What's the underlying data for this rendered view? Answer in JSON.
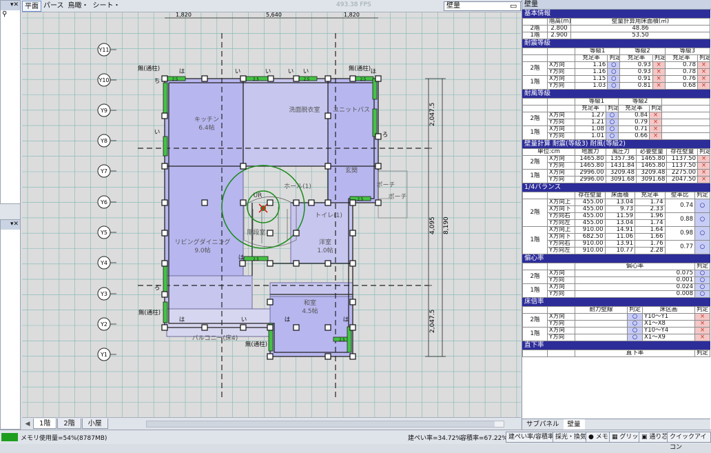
{
  "toolbar": {
    "modes": [
      "平面",
      "パース",
      "鳥瞰・",
      "シート・"
    ],
    "fps": "493.38 FPS",
    "layer": "壁量"
  },
  "floor_tabs": [
    "1階",
    "2階",
    "小屋"
  ],
  "plan": {
    "grid_y": [
      "Y11",
      "Y10",
      "Y9",
      "Y8",
      "Y7",
      "Y6",
      "Y5",
      "Y4",
      "Y3",
      "Y2",
      "Y1"
    ],
    "rooms": {
      "kitchen": "キッチン",
      "kitchen_size": "6.4帖",
      "washroom": "洗面脱衣室",
      "bath": "ユニットバス",
      "entrance": "玄関",
      "hall": "ホール(1)",
      "porch": "ポーチ",
      "porch2": "ポーチ",
      "toilet": "トイレ(1)",
      "living": "リビングダイニング",
      "living_size": "9.0帖",
      "western": "洋室",
      "western_size": "1.0帖",
      "japanese": "和室",
      "japanese_size": "4.5帖",
      "stair": "階段室",
      "balcony": "バルコニー(床4)",
      "ur": "UR"
    },
    "labels": {
      "mu_tsuchu": "無(通柱)",
      "ha": "は",
      "i": "い",
      "ho": "ほ",
      "ro": "ろ",
      "chi": "ち",
      "wall25": "2.5"
    },
    "dims": {
      "top1": "1,820",
      "top2": "5,640",
      "top3": "1,820",
      "right1": "2,047.5",
      "right2": "4,095",
      "right3": "8,190",
      "right4": "2,047.5"
    }
  },
  "panel": {
    "title": "壁量",
    "basic": {
      "head": "基本情報",
      "col_height": "階高(m)",
      "col_area": "壁量計算用床面積(㎡)",
      "rows": [
        [
          "2階",
          "2.800",
          "48.86"
        ],
        [
          "1階",
          "2.900",
          "53.50"
        ]
      ]
    },
    "seismic": {
      "head": "耐震等級",
      "grades": [
        "等級1",
        "等級2",
        "等級3"
      ],
      "sub_ratio": "充足率",
      "sub_judge": "判定",
      "rows": [
        [
          "2階",
          "X方向",
          "1.16",
          "○",
          "0.93",
          "×",
          "0.78",
          "×"
        ],
        [
          "",
          "Y方向",
          "1.16",
          "○",
          "0.93",
          "×",
          "0.78",
          "×"
        ],
        [
          "1階",
          "X方向",
          "1.15",
          "○",
          "0.91",
          "×",
          "0.76",
          "×"
        ],
        [
          "",
          "Y方向",
          "1.03",
          "○",
          "0.81",
          "×",
          "0.68",
          "×"
        ]
      ]
    },
    "wind": {
      "head": "耐風等級",
      "grades": [
        "等級1",
        "等級2"
      ],
      "rows": [
        [
          "2階",
          "X方向",
          "1.27",
          "○",
          "0.84",
          "×"
        ],
        [
          "",
          "Y方向",
          "1.21",
          "○",
          "0.79",
          "×"
        ],
        [
          "1階",
          "X方向",
          "1.08",
          "○",
          "0.71",
          "×"
        ],
        [
          "",
          "Y方向",
          "1.01",
          "○",
          "0.66",
          "×"
        ]
      ]
    },
    "calc": {
      "head": "壁量計算 耐震(等級3) 耐風(等級2)",
      "cols": [
        "単位:cm",
        "地震力",
        "風圧力",
        "必要壁量",
        "存在壁量",
        "判定"
      ],
      "rows": [
        [
          "2階",
          "X方向",
          "1465.80",
          "1357.36",
          "1465.80",
          "1137.50",
          "×"
        ],
        [
          "",
          "Y方向",
          "1465.80",
          "1431.84",
          "1465.80",
          "1137.50",
          "×"
        ],
        [
          "1階",
          "X方向",
          "2996.00",
          "3209.48",
          "3209.48",
          "2275.00",
          "×"
        ],
        [
          "",
          "Y方向",
          "2996.00",
          "3091.68",
          "3091.68",
          "2047.50",
          "×"
        ]
      ]
    },
    "balance": {
      "head": "1/4バランス",
      "cols": [
        "存在壁量",
        "床面積",
        "充足率",
        "壁率比",
        "判定"
      ],
      "rows": [
        [
          "2階",
          "X方向上",
          "455.00",
          "13.04",
          "1.74",
          "0.74",
          "○"
        ],
        [
          "",
          "X方向下",
          "455.00",
          "9.73",
          "2.33",
          "",
          ""
        ],
        [
          "",
          "Y方向右",
          "455.00",
          "11.59",
          "1.96",
          "0.88",
          "○"
        ],
        [
          "",
          "Y方向左",
          "455.00",
          "13.04",
          "1.74",
          "",
          ""
        ],
        [
          "1階",
          "X方向上",
          "910.00",
          "14.91",
          "1.64",
          "0.98",
          "○"
        ],
        [
          "",
          "X方向下",
          "682.50",
          "11.06",
          "1.66",
          "",
          ""
        ],
        [
          "",
          "Y方向右",
          "910.00",
          "13.91",
          "1.76",
          "0.77",
          "○"
        ],
        [
          "",
          "Y方向左",
          "910.00",
          "10.77",
          "2.28",
          "",
          ""
        ]
      ]
    },
    "eccentric": {
      "head": "偏心率",
      "col": "偏心率",
      "judge": "判定",
      "rows": [
        [
          "2階",
          "X方向",
          "0.075",
          "○"
        ],
        [
          "",
          "Y方向",
          "0.001",
          "○"
        ],
        [
          "1階",
          "X方向",
          "0.024",
          "○"
        ],
        [
          "",
          "Y方向",
          "0.008",
          "○"
        ]
      ]
    },
    "floor": {
      "head": "床倍率",
      "cols": [
        "耐力壁線",
        "判定",
        "床区画",
        "判定"
      ],
      "rows": [
        [
          "2階",
          "X方向",
          "",
          "○",
          "Y10〜Y1",
          "×"
        ],
        [
          "",
          "Y方向",
          "",
          "○",
          "X1〜X8",
          "×"
        ],
        [
          "1階",
          "X方向",
          "",
          "○",
          "Y10〜Y4",
          "×"
        ],
        [
          "",
          "Y方向",
          "",
          "○",
          "X1〜X9",
          "×"
        ]
      ]
    },
    "direct": {
      "head": "直下率",
      "col": "直下率",
      "judge": "判定"
    },
    "tabs": [
      "サブパネル",
      "壁量"
    ]
  },
  "status": {
    "memory": "メモリ使用量=54%(8787MB)",
    "bcr": "建ぺい率=34.72%",
    "far": "容積率=67.22%",
    "bcr_far": "建ぺい率/容積率",
    "light": "採光・換気",
    "memo": "メモ",
    "grid": "グリッド",
    "snap": "通り芯",
    "quick": "クイックアイコン"
  },
  "colors": {
    "section_head": "#2d2d9a",
    "ok_fill": "#c7cdf4",
    "ng_fill": "#f5c7c7",
    "room_fill": "#b7b6ef",
    "wall_green": "#44c244"
  }
}
